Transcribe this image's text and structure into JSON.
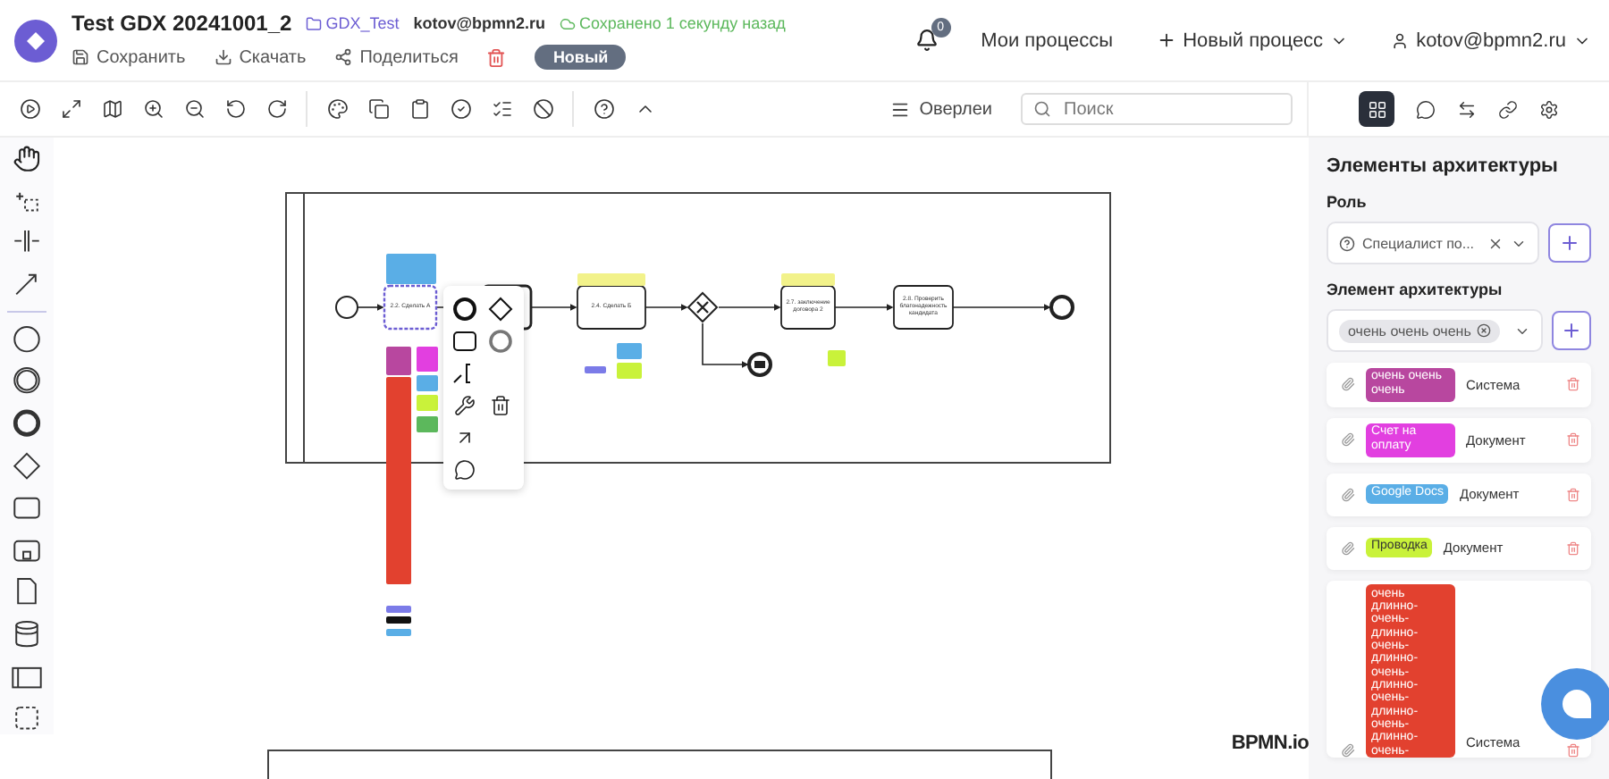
{
  "header": {
    "title": "Test GDX 20241001_2",
    "folder": "GDX_Test",
    "owner": "kotov@bpmn2.ru",
    "save_status": "Сохранено 1 секунду назад",
    "actions": [
      {
        "kind": "save",
        "label": "Сохранить"
      },
      {
        "kind": "download",
        "label": "Скачать"
      },
      {
        "kind": "share",
        "label": "Поделиться"
      },
      {
        "kind": "delete"
      }
    ],
    "status_badge": "Новый",
    "notifications": "0",
    "my_processes": "Мои процессы",
    "new_process": "Новый процесс",
    "user": "kotov@bpmn2.ru"
  },
  "toolbar": {
    "overlays": "Оверлеи",
    "search": {
      "placeholder": "Поиск"
    },
    "panel_tabs": [
      {
        "kind": "grid",
        "selected": true
      },
      {
        "kind": "comments",
        "selected": false
      },
      {
        "kind": "swap",
        "selected": false
      },
      {
        "kind": "link",
        "selected": false
      },
      {
        "kind": "settings",
        "selected": false
      }
    ]
  },
  "diagram": {
    "tasks": [
      {
        "label": "2.2. Сделать А",
        "selected": true
      },
      {
        "label": "2.4. Сделать Б",
        "selected": false
      },
      {
        "label": "2.7. заключение договора 2",
        "selected": false
      },
      {
        "label": "2.8. Проверить благонадежность кандидата",
        "selected": false
      }
    ],
    "logo": "BPMN.io"
  },
  "panel": {
    "title": "Элементы архитектуры",
    "role_label": "Роль",
    "role_value": "Специалист по...",
    "element_label": "Элемент архитектуры",
    "element_chip": "очень очень очень",
    "items": [
      {
        "tag": "очень очень очень",
        "type": "Система",
        "color": "#b8479f"
      },
      {
        "tag": "Счет на оплату",
        "type": "Документ",
        "color": "#e23fe0"
      },
      {
        "tag": "Google Docs",
        "type": "Документ",
        "color": "#5aaee6"
      },
      {
        "tag": "Проводка",
        "type": "Документ",
        "color": "#c9f23a"
      },
      {
        "tag": "очень длинно-очень-длинно-очень-длинно-очень-длинно-очень-длинно-очень-длинно-очень-",
        "type": "Система",
        "color": "#e2412f"
      }
    ]
  }
}
